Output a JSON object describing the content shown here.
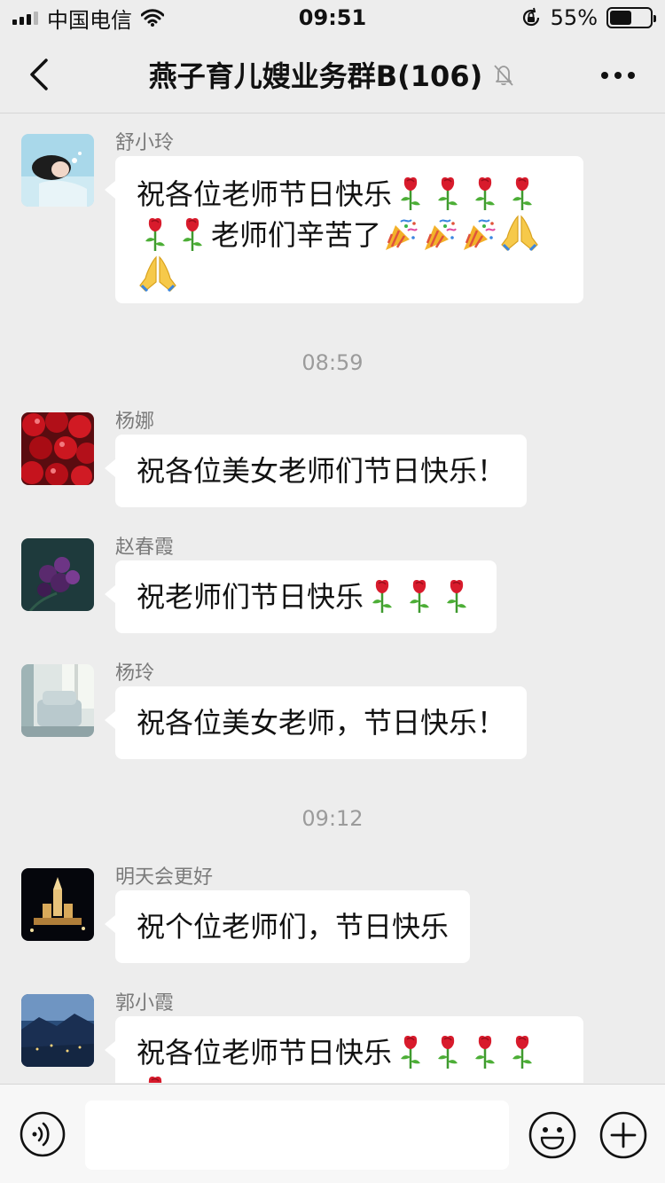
{
  "status_bar": {
    "carrier": "中国电信",
    "time": "09:51",
    "battery_percent": "55%",
    "battery_level": 0.55
  },
  "nav": {
    "title": "燕子育儿嫂业务群B(106)",
    "back_icon": "chevron-left-icon",
    "mute_icon": "bell-mute-icon",
    "more_icon": "more-dots-icon"
  },
  "timestamps": [
    "08:59",
    "09:12"
  ],
  "messages": [
    {
      "sender": "舒小玲",
      "line1": "祝各位老师节日快乐",
      "line2": "老师们辛苦了"
    },
    {
      "sender": "杨娜",
      "text": "祝各位美女老师们节日快乐！"
    },
    {
      "sender": "赵春霞",
      "text": "祝老师们节日快乐"
    },
    {
      "sender": "杨玲",
      "text": "祝各位美女老师，节日快乐！"
    },
    {
      "sender": "明天会更好",
      "text": "祝个位老师们，节日快乐"
    },
    {
      "sender": "郭小霞",
      "text": "祝各位老师节日快乐"
    }
  ],
  "input_bar": {
    "voice_icon": "voice-icon",
    "emoji_icon": "smile-icon",
    "plus_icon": "plus-icon",
    "input_value": ""
  },
  "colors": {
    "background": "#ededed",
    "bubble": "#ffffff",
    "sender_text": "#7a7a7a",
    "timestamp_text": "#9b9b9b"
  }
}
